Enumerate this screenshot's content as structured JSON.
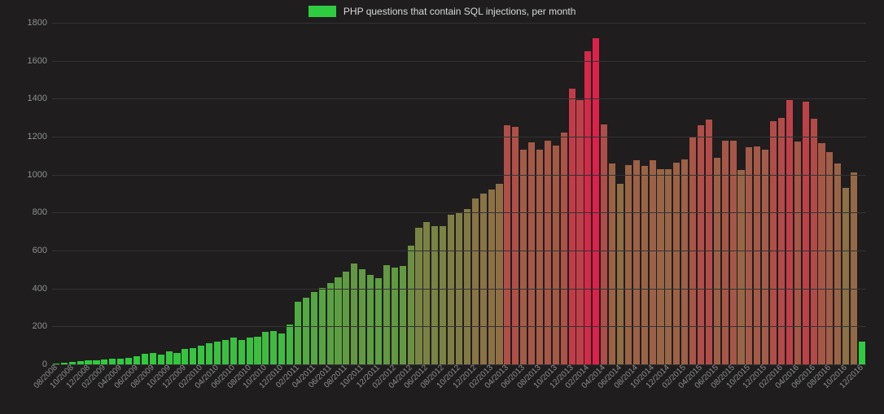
{
  "legend": {
    "label": "PHP questions that contain SQL injections, per month"
  },
  "chart_data": {
    "type": "bar",
    "title": "",
    "xlabel": "",
    "ylabel": "",
    "ylim": [
      0,
      1800
    ],
    "yticks": [
      0,
      200,
      400,
      600,
      800,
      1000,
      1200,
      1400,
      1600,
      1800
    ],
    "x_tick_every": 2,
    "color_scale": {
      "low": "#2ecc40",
      "high": "#e6194b",
      "min": 0,
      "max": 1800
    },
    "categories": [
      "08/2008",
      "09/2008",
      "10/2008",
      "11/2008",
      "12/2008",
      "01/2009",
      "02/2009",
      "03/2009",
      "04/2009",
      "05/2009",
      "06/2009",
      "07/2009",
      "08/2009",
      "09/2009",
      "10/2009",
      "11/2009",
      "12/2009",
      "01/2010",
      "02/2010",
      "03/2010",
      "04/2010",
      "05/2010",
      "06/2010",
      "07/2010",
      "08/2010",
      "09/2010",
      "10/2010",
      "11/2010",
      "12/2010",
      "01/2011",
      "02/2011",
      "03/2011",
      "04/2011",
      "05/2011",
      "06/2011",
      "07/2011",
      "08/2011",
      "09/2011",
      "10/2011",
      "11/2011",
      "12/2011",
      "01/2012",
      "02/2012",
      "03/2012",
      "04/2012",
      "05/2012",
      "06/2012",
      "07/2012",
      "08/2012",
      "09/2012",
      "10/2012",
      "11/2012",
      "12/2012",
      "01/2013",
      "02/2013",
      "03/2013",
      "04/2013",
      "05/2013",
      "06/2013",
      "07/2013",
      "08/2013",
      "09/2013",
      "10/2013",
      "11/2013",
      "12/2013",
      "01/2014",
      "02/2014",
      "03/2014",
      "04/2014",
      "05/2014",
      "06/2014",
      "07/2014",
      "08/2014",
      "09/2014",
      "10/2014",
      "11/2014",
      "12/2014",
      "01/2015",
      "02/2015",
      "03/2015",
      "04/2015",
      "05/2015",
      "06/2015",
      "07/2015",
      "08/2015",
      "09/2015",
      "10/2015",
      "11/2015",
      "12/2015",
      "01/2016",
      "02/2016",
      "03/2016",
      "04/2016",
      "05/2016",
      "06/2016",
      "07/2016",
      "08/2016",
      "09/2016",
      "10/2016",
      "11/2016",
      "12/2016"
    ],
    "values": [
      5,
      8,
      12,
      18,
      20,
      22,
      25,
      30,
      28,
      35,
      45,
      55,
      60,
      50,
      70,
      60,
      80,
      85,
      100,
      110,
      120,
      130,
      140,
      130,
      140,
      145,
      170,
      175,
      165,
      210,
      330,
      350,
      380,
      405,
      430,
      460,
      490,
      530,
      500,
      470,
      455,
      525,
      510,
      520,
      625,
      720,
      750,
      730,
      730,
      790,
      800,
      820,
      875,
      900,
      920,
      950,
      1260,
      1250,
      1130,
      1170,
      1130,
      1180,
      1155,
      1220,
      1455,
      1395,
      1650,
      1720,
      1265,
      1060,
      950,
      1050,
      1075,
      1045,
      1075,
      1030,
      1030,
      1065,
      1080,
      1200,
      1260,
      1290,
      1090,
      1180,
      1180,
      1025,
      1145,
      1150,
      1130,
      1280,
      1300,
      1395,
      1175,
      1385,
      1295,
      1165,
      1120,
      1060,
      930,
      1010,
      120
    ]
  }
}
